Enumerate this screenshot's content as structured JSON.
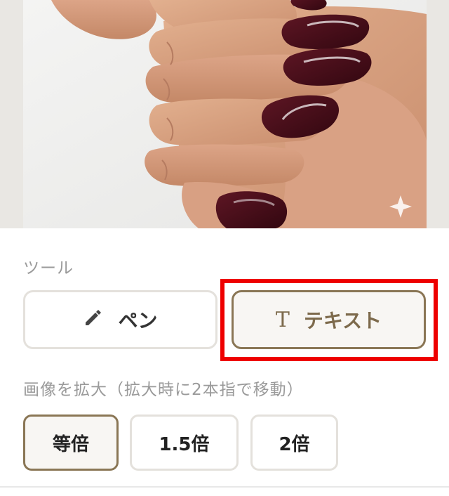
{
  "tools": {
    "section_label": "ツール",
    "pen_label": "ペン",
    "text_label": "テキスト",
    "text_icon_glyph": "T",
    "selected": "text"
  },
  "zoom": {
    "section_label": "画像を拡大（拡大時に2本指で移動）",
    "options": [
      "等倍",
      "1.5倍",
      "2倍"
    ],
    "selected": "等倍"
  },
  "colors": {
    "accent": "#8a7655",
    "highlight": "#ee0000",
    "nail_polish": "#4a0f1c"
  }
}
